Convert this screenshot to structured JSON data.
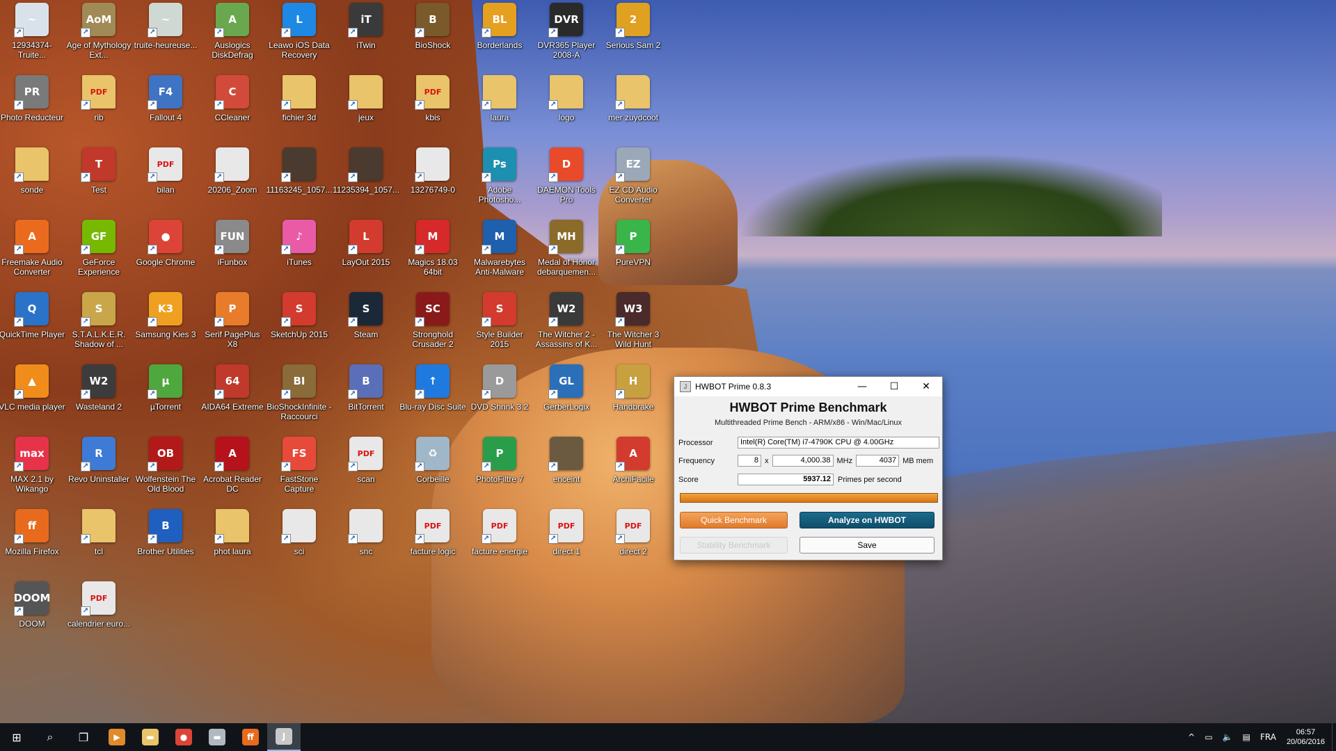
{
  "desktop": {
    "icons": [
      {
        "label": "12934374-Truite...",
        "glyph": "~",
        "color": "#d9e2ea"
      },
      {
        "label": "Photo Reducteur",
        "glyph": "PR",
        "color": "#7a7a7a"
      },
      {
        "label": "sonde",
        "glyph": "",
        "color": "#e9c46a"
      },
      {
        "label": "Freemake Audio Converter",
        "glyph": "A",
        "color": "#ea6b1d"
      },
      {
        "label": "QuickTime Player",
        "glyph": "Q",
        "color": "#2a73c9"
      },
      {
        "label": "VLC media player",
        "glyph": "▲",
        "color": "#f08c1a"
      },
      {
        "label": "MAX 2.1 by Wikango",
        "glyph": "max",
        "color": "#e6334a"
      },
      {
        "label": "Mozilla Firefox",
        "glyph": "ff",
        "color": "#e86a1c"
      },
      {
        "label": "DOOM",
        "glyph": "DOOM",
        "color": "#555555"
      },
      {
        "label": "Age of Mythology Ext...",
        "glyph": "AoM",
        "color": "#a08a55"
      },
      {
        "label": "rib",
        "glyph": "PDF",
        "color": "#e9c46a"
      },
      {
        "label": "Test",
        "glyph": "T",
        "color": "#c0392b"
      },
      {
        "label": "GeForce Experience",
        "glyph": "GF",
        "color": "#76b900"
      },
      {
        "label": "S.T.A.L.K.E.R. Shadow of ...",
        "glyph": "S",
        "color": "#c9a64a"
      },
      {
        "label": "Wasteland 2",
        "glyph": "W2",
        "color": "#3c3c3c"
      },
      {
        "label": "Revo Uninstaller",
        "glyph": "R",
        "color": "#3e7bd6"
      },
      {
        "label": "tcl",
        "glyph": "",
        "color": "#e9c46a"
      },
      {
        "label": "calendrier euro...",
        "glyph": "PDF",
        "color": "#e8e8e8"
      },
      {
        "label": "truite-heureuse...",
        "glyph": "~",
        "color": "#cfd8d2"
      },
      {
        "label": "Fallout 4",
        "glyph": "F4",
        "color": "#3f73c4"
      },
      {
        "label": "bilan",
        "glyph": "PDF",
        "color": "#e8e8e8"
      },
      {
        "label": "Google Chrome",
        "glyph": "●",
        "color": "#db4437"
      },
      {
        "label": "Samsung Kies 3",
        "glyph": "K3",
        "color": "#f0a020"
      },
      {
        "label": "µTorrent",
        "glyph": "µ",
        "color": "#4fa83d"
      },
      {
        "label": "Wolfenstein The Old Blood",
        "glyph": "OB",
        "color": "#b21a1a"
      },
      {
        "label": "Brother Utilities",
        "glyph": "B",
        "color": "#1f5fbf"
      },
      {
        "label": "",
        "glyph": "",
        "color": "transparent"
      },
      {
        "label": "Auslogics DiskDefrag",
        "glyph": "A",
        "color": "#6aa84f"
      },
      {
        "label": "CCleaner",
        "glyph": "C",
        "color": "#d24a3a"
      },
      {
        "label": "20206_Zoom",
        "glyph": "",
        "color": "#e8e8e8"
      },
      {
        "label": "iFunbox",
        "glyph": "FUN",
        "color": "#8a8a8a"
      },
      {
        "label": "Serif PagePlus X8",
        "glyph": "P",
        "color": "#e87c2a"
      },
      {
        "label": "AIDA64 Extreme",
        "glyph": "64",
        "color": "#c0392b"
      },
      {
        "label": "Acrobat Reader DC",
        "glyph": "A",
        "color": "#b5121b"
      },
      {
        "label": "phot laura",
        "glyph": "",
        "color": "#e9c46a"
      },
      {
        "label": "",
        "glyph": "",
        "color": "transparent"
      },
      {
        "label": "Leawo iOS Data Recovery",
        "glyph": "L",
        "color": "#1e88e5"
      },
      {
        "label": "fichier 3d",
        "glyph": "",
        "color": "#e9c46a"
      },
      {
        "label": "11163245_1057...",
        "glyph": "",
        "color": "#4a3a30"
      },
      {
        "label": "iTunes",
        "glyph": "♪",
        "color": "#e95ba7"
      },
      {
        "label": "SketchUp 2015",
        "glyph": "S",
        "color": "#d23b2e"
      },
      {
        "label": "BioShockInfinite - Raccourci",
        "glyph": "BI",
        "color": "#8a6b3a"
      },
      {
        "label": "FastStone Capture",
        "glyph": "FS",
        "color": "#e84a3a"
      },
      {
        "label": "sci",
        "glyph": "",
        "color": "#e8e8e8"
      },
      {
        "label": "",
        "glyph": "",
        "color": "transparent"
      },
      {
        "label": "iTwin",
        "glyph": "iT",
        "color": "#3a3a3a"
      },
      {
        "label": "jeux",
        "glyph": "",
        "color": "#e9c46a"
      },
      {
        "label": "11235394_1057...",
        "glyph": "",
        "color": "#4a3a30"
      },
      {
        "label": "LayOut 2015",
        "glyph": "L",
        "color": "#d23b2e"
      },
      {
        "label": "Steam",
        "glyph": "S",
        "color": "#1b2838"
      },
      {
        "label": "BitTorrent",
        "glyph": "B",
        "color": "#5a6fb8"
      },
      {
        "label": "scan",
        "glyph": "PDF",
        "color": "#e8e8e8"
      },
      {
        "label": "snc",
        "glyph": "",
        "color": "#e8e8e8"
      },
      {
        "label": "",
        "glyph": "",
        "color": "transparent"
      },
      {
        "label": "BioShock",
        "glyph": "B",
        "color": "#7a5a2a"
      },
      {
        "label": "kbis",
        "glyph": "PDF",
        "color": "#e9c46a"
      },
      {
        "label": "13276749-0",
        "glyph": "",
        "color": "#e8e8e8"
      },
      {
        "label": "Magics 18.03 64bit",
        "glyph": "M",
        "color": "#d62a2a"
      },
      {
        "label": "Stronghold Crusader 2",
        "glyph": "SC",
        "color": "#8a1a1a"
      },
      {
        "label": "Blu-ray Disc Suite",
        "glyph": "↑",
        "color": "#1f7ae0"
      },
      {
        "label": "Corbeille",
        "glyph": "♻",
        "color": "#9fb7c8"
      },
      {
        "label": "facture logic",
        "glyph": "PDF",
        "color": "#e8e8e8"
      },
      {
        "label": "",
        "glyph": "",
        "color": "transparent"
      },
      {
        "label": "Borderlands",
        "glyph": "BL",
        "color": "#e6a020"
      },
      {
        "label": "laura",
        "glyph": "",
        "color": "#e9c46a"
      },
      {
        "label": "Adobe Photosho...",
        "glyph": "Ps",
        "color": "#1d8fb0"
      },
      {
        "label": "Malwarebytes Anti-Malware",
        "glyph": "M",
        "color": "#1e5fae"
      },
      {
        "label": "Style Builder 2015",
        "glyph": "S",
        "color": "#d23b2e"
      },
      {
        "label": "DVD Shrink 3.2",
        "glyph": "D",
        "color": "#9a9a9a"
      },
      {
        "label": "PhotoFiltre 7",
        "glyph": "P",
        "color": "#2a9d4a"
      },
      {
        "label": "facture energie",
        "glyph": "PDF",
        "color": "#e8e8e8"
      },
      {
        "label": "",
        "glyph": "",
        "color": "transparent"
      },
      {
        "label": "DVR365 Player 2008-A",
        "glyph": "DVR",
        "color": "#2a2a2a"
      },
      {
        "label": "logo",
        "glyph": "",
        "color": "#e9c46a"
      },
      {
        "label": "DAEMON Tools Pro",
        "glyph": "D",
        "color": "#e84a2a"
      },
      {
        "label": "Medal of Honor debarquemen...",
        "glyph": "MH",
        "color": "#8a6b2a"
      },
      {
        "label": "The Witcher 2 - Assassins of K...",
        "glyph": "W2",
        "color": "#3a3a3a"
      },
      {
        "label": "GerberLogix",
        "glyph": "GL",
        "color": "#2a6fb8"
      },
      {
        "label": "enceint",
        "glyph": "",
        "color": "#6b5a40"
      },
      {
        "label": "direct 1",
        "glyph": "PDF",
        "color": "#e8e8e8"
      },
      {
        "label": "",
        "glyph": "",
        "color": "transparent"
      },
      {
        "label": "Serious Sam 2",
        "glyph": "2",
        "color": "#e0a020"
      },
      {
        "label": "mer zuydcoot",
        "glyph": "",
        "color": "#e9c46a"
      },
      {
        "label": "EZ CD Audio Converter",
        "glyph": "EZ",
        "color": "#9aa8b8"
      },
      {
        "label": "PureVPN",
        "glyph": "P",
        "color": "#3ab54a"
      },
      {
        "label": "The Witcher 3 Wild Hunt",
        "glyph": "W3",
        "color": "#4a2a2a"
      },
      {
        "label": "Handbrake",
        "glyph": "H",
        "color": "#c8a040"
      },
      {
        "label": "ArchiFacile",
        "glyph": "A",
        "color": "#d23b2e"
      },
      {
        "label": "direct 2",
        "glyph": "PDF",
        "color": "#e8e8e8"
      },
      {
        "label": "",
        "glyph": "",
        "color": "transparent"
      }
    ]
  },
  "window": {
    "title": "HWBOT Prime 0.8.3",
    "heading": "HWBOT Prime Benchmark",
    "subheading": "Multithreaded Prime Bench - ARM/x86 - Win/Mac/Linux",
    "processor_label": "Processor",
    "processor_value": "Intel(R) Core(TM) i7-4790K CPU @ 4.00GHz",
    "frequency_label": "Frequency",
    "cores": "8",
    "multiply_sign": "x",
    "frequency_value": "4,000.38",
    "frequency_unit": "MHz",
    "memory_value": "4037",
    "memory_unit": "MB mem",
    "score_label": "Score",
    "score_value": "5937.12",
    "score_unit": "Primes per second",
    "progress": 1.0,
    "quick_benchmark_label": "Quick Benchmark",
    "analyze_label": "Analyze on HWBOT",
    "stability_label": "Stability Benchmark",
    "save_label": "Save",
    "minimize_glyph": "—",
    "maximize_glyph": "☐",
    "close_glyph": "✕"
  },
  "taskbar": {
    "start_glyph": "⊞",
    "search_glyph": "⌕",
    "taskview_glyph": "❐",
    "pinned": [
      {
        "name": "media-player",
        "glyph": "▶",
        "color": "#e08a2a"
      },
      {
        "name": "file-explorer",
        "glyph": "▬",
        "color": "#e9c46a"
      },
      {
        "name": "chrome",
        "glyph": "●",
        "color": "#db4437"
      },
      {
        "name": "folder",
        "glyph": "▬",
        "color": "#b0b8c0"
      },
      {
        "name": "firefox",
        "glyph": "ff",
        "color": "#e86a1c"
      },
      {
        "name": "java-hwbot",
        "glyph": "J",
        "color": "#c8c8c8"
      }
    ],
    "tray": {
      "chevron": "^",
      "network": "▭",
      "volume": "🔈",
      "notification": "▤",
      "language": "FRA",
      "time": "06:57",
      "date": "20/06/2016"
    }
  },
  "colors": {
    "accent_orange": "#e07b2c",
    "accent_teal": "#0e4e6b"
  }
}
